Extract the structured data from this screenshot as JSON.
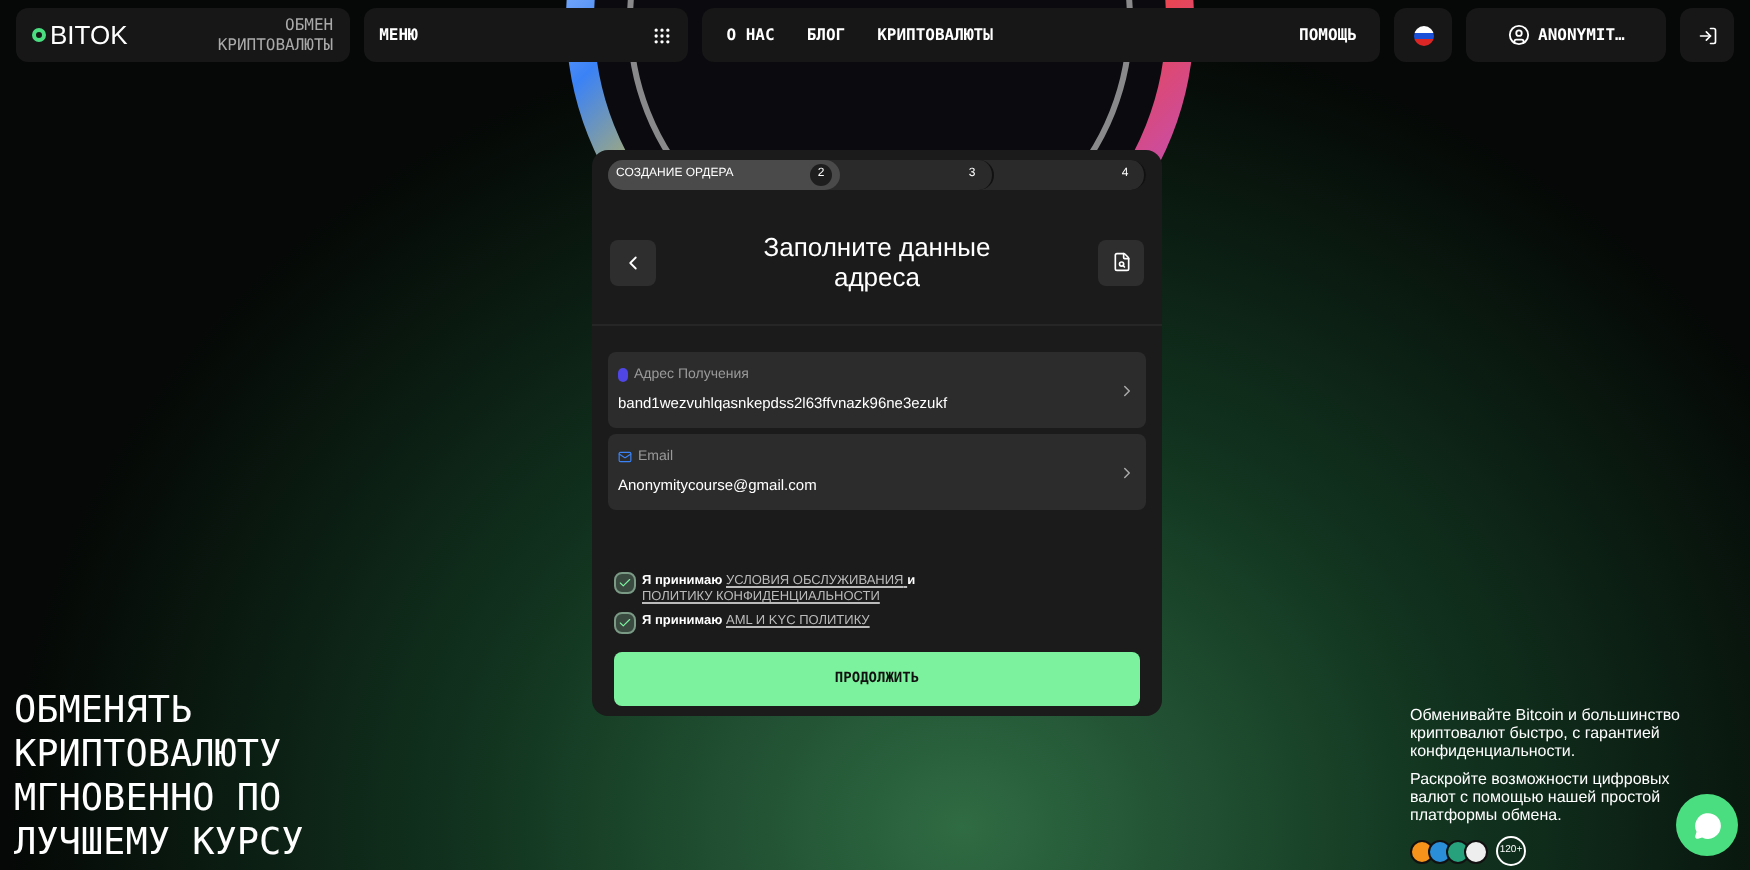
{
  "header": {
    "logo": "BITOK",
    "logo_caption": "ОБМЕН КРИПТОВАЛЮТЫ",
    "menu": "МЕНЮ",
    "nav": [
      "О НАС",
      "БЛОГ",
      "КРИПТОВАЛЮТЫ"
    ],
    "help": "ПОМОЩЬ",
    "user": "ANONYMIT…"
  },
  "steps": [
    {
      "label": "СОЗДАНИЕ ОРДЕРА",
      "number": "2",
      "selected": true
    },
    {
      "number": "3",
      "selected": false
    },
    {
      "number": "4",
      "selected": false
    }
  ],
  "title": "Заполните данные адреса",
  "fields": [
    {
      "kind": "wallet",
      "label": "Адрес Получения",
      "value": "band1wezvuhlqasnkepdss2l63ffvnazk96ne3ezukf"
    },
    {
      "kind": "email",
      "label": "Email",
      "value": "Anonymitycourse@gmail.com"
    }
  ],
  "agreements": [
    {
      "checked": true,
      "parts": [
        {
          "kind": "text",
          "text": "Я принимаю"
        },
        {
          "kind": "link",
          "text": "УСЛОВИЯ ОБСЛУЖИВАНИЯ"
        },
        {
          "kind": "text",
          "text": "и"
        },
        {
          "kind": "link",
          "text": "ПОЛИТИКУ КОНФИДЕНЦИАЛЬНОСТИ"
        }
      ]
    },
    {
      "checked": true,
      "parts": [
        {
          "kind": "text",
          "text": "Я принимаю"
        },
        {
          "kind": "link",
          "text": "AML И KYC ПОЛИТИКУ"
        }
      ]
    }
  ],
  "continue_button": "ПРОДОЛЖИТЬ",
  "headline": "ОБМЕНЯТЬ КРИПТОВАЛЮТУ МГНОВЕННО ПО ЛУЧШЕМУ КУРСУ",
  "promo": [
    "Обменивайте Bitcoin и большинство криптовалют быстро, с гарантией конфиденциальности.",
    "Раскройте возможности цифровых валют с помощью нашей простой платформы обмена."
  ],
  "coins": [
    {
      "color": "#f7931a"
    },
    {
      "color": "#2a8fd8"
    },
    {
      "color": "#26a17b"
    },
    {
      "color": "#eeeeee"
    }
  ],
  "coins_more": "120+"
}
